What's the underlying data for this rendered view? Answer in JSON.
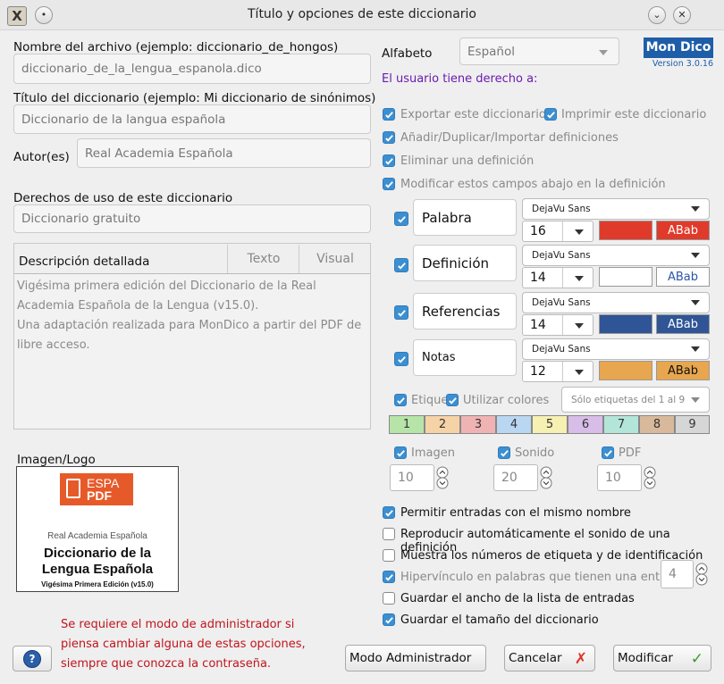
{
  "window": {
    "title": "Título y opciones de este diccionario"
  },
  "left": {
    "filename_label": "Nombre del archivo (ejemplo: diccionario_de_hongos)",
    "filename_value": "diccionario_de_la_lengua_espanola.dico",
    "title_label": "Título del diccionario (ejemplo: Mi diccionario de sinónimos)",
    "title_value": "Diccionario de la langua española",
    "author_label": "Autor(es)",
    "author_value": "Real Academia Española",
    "rights_label": "Derechos de uso de este diccionario",
    "rights_value": "Diccionario gratuito",
    "description_label": "Descripción detallada",
    "tab_text": "Texto",
    "tab_visual": "Visual",
    "description_p1": "Vigésima primera edición del Diccionario de la Real Academia Española de la Lengua (v15.0).",
    "description_p2": "Una adaptación realizada para MonDico a partir del PDF de libre acceso.",
    "image_label": "Imagen/Logo",
    "logo": {
      "badge_top": "ESPA",
      "badge_bottom": "PDF",
      "publisher": "Real Academia Española",
      "line1": "Diccionario de la",
      "line2": "Lengua Española",
      "edition": "Vigésima Primera Edición (v15.0)"
    },
    "admin_warning": "Se requiere el modo de administrador si piensa cambiar alguna de estas opciones, siempre que conozca la contraseña."
  },
  "right": {
    "alphabet_label": "Alfabeto",
    "alphabet_value": "Español",
    "brand": "Mon Dico",
    "version": "Version 3.0.16",
    "rights_heading": "El usuario tiene derecho a:",
    "rights": {
      "export": "Exportar este diccionario",
      "print": "Imprimir este diccionario",
      "add": "Añadir/Duplicar/Importar definiciones",
      "delete": "Eliminar una definición",
      "modify": "Modificar estos campos abajo en la definición"
    },
    "fields": [
      {
        "name": "Palabra",
        "font": "DejaVu Sans",
        "size": "16",
        "color": "#e03a2b",
        "sample": "ABab",
        "sample_bg": "#e03a2b",
        "sample_fg": "#ffffff"
      },
      {
        "name": "Definición",
        "font": "DejaVu Sans",
        "size": "14",
        "color": "#ffffff",
        "sample": "ABab",
        "sample_bg": "#ffffff",
        "sample_fg": "#2b55a8"
      },
      {
        "name": "Referencias",
        "font": "DejaVu Sans",
        "size": "14",
        "color": "#2f5597",
        "sample": "ABab",
        "sample_bg": "#2f5597",
        "sample_fg": "#ffffff"
      },
      {
        "name": "Notas",
        "font": "DejaVu Sans",
        "size": "12",
        "color": "#e8a64f",
        "sample": "ABab",
        "sample_bg": "#e8a64f",
        "sample_fg": "#111111"
      }
    ],
    "tags_label": "Etique",
    "use_colors_label": "Utilizar colores",
    "tags_select": "Sólo etiquetas del 1 al 9",
    "tags": [
      {
        "n": "1",
        "bg": "#b7e4a8"
      },
      {
        "n": "2",
        "bg": "#f6d3a6"
      },
      {
        "n": "3",
        "bg": "#f0b3b3"
      },
      {
        "n": "4",
        "bg": "#b9d7f0"
      },
      {
        "n": "5",
        "bg": "#f6f0b2"
      },
      {
        "n": "6",
        "bg": "#d8bde8"
      },
      {
        "n": "7",
        "bg": "#b3e6d8"
      },
      {
        "n": "8",
        "bg": "#d8b99b"
      },
      {
        "n": "9",
        "bg": "#d6d6d6"
      }
    ],
    "media": {
      "image_label": "Imagen",
      "image_value": "10",
      "sound_label": "Sonido",
      "sound_value": "20",
      "pdf_label": "PDF",
      "pdf_value": "10"
    },
    "options": {
      "same_name": "Permitir entradas con el mismo nombre",
      "autoplay": "Reproducir automáticamente el sonido de una definición",
      "show_numbers": "Muestra los números de etiqueta y de identificación",
      "hyperlink": "Hipervínculo en palabras que tienen una entrada",
      "hyperlink_value": "4",
      "save_width": "Guardar el ancho de la lista de entradas",
      "save_size": "Guardar el tamaño del diccionario"
    }
  },
  "buttons": {
    "admin": "Modo Administrador",
    "cancel": "Cancelar",
    "modify": "Modificar"
  }
}
